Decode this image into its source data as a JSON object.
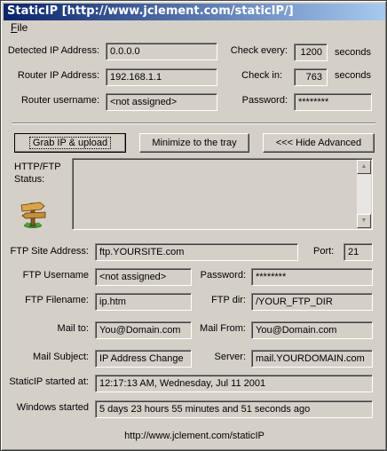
{
  "window": {
    "title": "StaticIP [http://www.jclement.com/staticIP/]"
  },
  "menu": {
    "file_accel": "F",
    "file_rest": "ile"
  },
  "top": {
    "detected_ip_label": "Detected IP Address:",
    "detected_ip_value": "0.0.0.0",
    "router_ip_label": "Router IP Address:",
    "router_ip_value": "192.168.1.1",
    "router_user_label": "Router username:",
    "router_user_value": "<not assigned>",
    "check_every_label": "Check every:",
    "check_every_value": "1200",
    "check_every_unit": "seconds",
    "check_in_label": "Check in:",
    "check_in_value": "763",
    "check_in_unit": "seconds",
    "password_label": "Password:",
    "password_value": "********"
  },
  "buttons": {
    "grab": "Grab IP & upload",
    "minimize": "Minimize to the tray",
    "hide_advanced": "<<< Hide Advanced"
  },
  "status": {
    "label_line1": "HTTP/FTP",
    "label_line2": "Status:",
    "text": ""
  },
  "ftp": {
    "site_label": "FTP Site Address:",
    "site_value": "ftp.YOURSITE.com",
    "port_label": "Port:",
    "port_value": "21",
    "user_label": "FTP Username",
    "user_value": "<not assigned>",
    "password_label": "Password:",
    "password_value": "********",
    "filename_label": "FTP Filename:",
    "filename_value": "ip.htm",
    "dir_label": "FTP dir:",
    "dir_value": "/YOUR_FTP_DIR"
  },
  "mail": {
    "to_label": "Mail to:",
    "to_value": "You@Domain.com",
    "from_label": "Mail From:",
    "from_value": "You@Domain.com",
    "subject_label": "Mail Subject:",
    "subject_value": "IP Address Change",
    "server_label": "Server:",
    "server_value": "mail.YOURDOMAIN.com"
  },
  "info": {
    "started_label": "StaticIP started at:",
    "started_value": "12:17:13 AM, Wednesday, Jul 11 2001",
    "windows_label": "Windows started",
    "windows_value": "5 days 23 hours 55 minutes and 51 seconds ago"
  },
  "footer": {
    "url": "http://www.jclement.com/staticIP"
  }
}
